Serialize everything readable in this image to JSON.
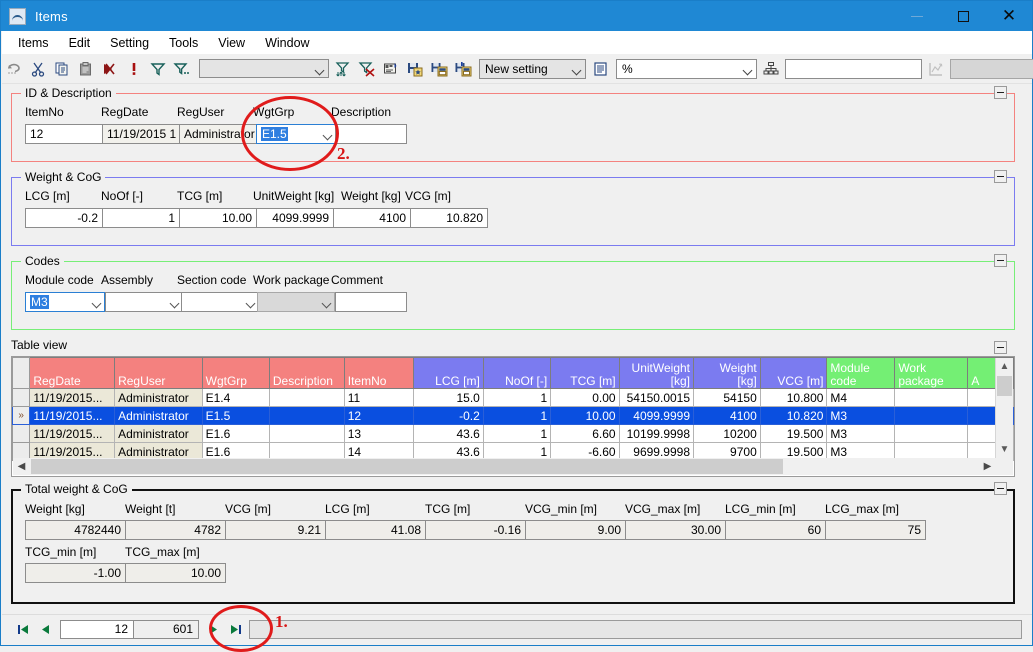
{
  "window": {
    "title": "Items",
    "icon": "app-icon",
    "buttons": {
      "minimize": "—",
      "maximize": "□",
      "close": "✕"
    }
  },
  "menu": {
    "items": [
      "Items",
      "Edit",
      "Setting",
      "Tools",
      "View",
      "Window"
    ]
  },
  "toolbar": {
    "icons": [
      "undo-icon",
      "cut-icon",
      "copy-icon",
      "paste-icon",
      "delete-record-icon",
      "exclamation-icon",
      "filter-icon",
      "filter-dots-icon",
      "sort-filter-icon",
      "clear-filter-icon",
      "properties-icon",
      "save-new-icon",
      "save-as-icon",
      "save-all-icon"
    ],
    "setting_combo": {
      "value": "New setting",
      "placeholder": ""
    },
    "filter_combo": {
      "value": "",
      "placeholder": ""
    },
    "unit_combo": {
      "value": "%",
      "placeholder": ""
    },
    "tree_text": {
      "value": "",
      "placeholder": ""
    },
    "chart_combo": {
      "value": "",
      "placeholder": ""
    },
    "report_icon": "report-icon",
    "tree_icon": "hierarchy-icon",
    "graph_icon": "graph-icon",
    "exit_icon": "exit-icon"
  },
  "id_description": {
    "legend": "ID & Description",
    "labels": {
      "itemno": "ItemNo",
      "regdate": "RegDate",
      "reguser": "RegUser",
      "wgtgrp": "WgtGrp",
      "description": "Description"
    },
    "values": {
      "itemno": "12",
      "regdate": "11/19/2015 1",
      "reguser": "Administrator",
      "wgtgrp": "E1.5",
      "description": ""
    }
  },
  "weight_cog": {
    "legend": "Weight & CoG",
    "labels": {
      "lcg": "LCG [m]",
      "noof": "NoOf [-]",
      "tcg": "TCG [m]",
      "unitweight": "UnitWeight [kg]",
      "weight": "Weight [kg]",
      "vcg": "VCG [m]"
    },
    "values": {
      "lcg": "-0.2",
      "noof": "1",
      "tcg": "10.00",
      "unitweight": "4099.9999",
      "weight": "4100",
      "vcg": "10.820"
    }
  },
  "codes": {
    "legend": "Codes",
    "labels": {
      "module": "Module code",
      "assembly": "Assembly",
      "section": "Section code",
      "workpackage": "Work package",
      "comment": "Comment"
    },
    "values": {
      "module": "M3",
      "assembly": "",
      "section": "",
      "workpackage": "",
      "comment": ""
    }
  },
  "table_view": {
    "legend": "Table view",
    "columns": [
      {
        "label": "RegDate",
        "color": "pink",
        "align": "left"
      },
      {
        "label": "RegUser",
        "color": "pink",
        "align": "left"
      },
      {
        "label": "WgtGrp",
        "color": "pink",
        "align": "left"
      },
      {
        "label": "Description",
        "color": "pink",
        "align": "left"
      },
      {
        "label": "ItemNo",
        "color": "pink",
        "align": "left"
      },
      {
        "label": "LCG [m]",
        "color": "blue",
        "align": "right"
      },
      {
        "label": "NoOf [-]",
        "color": "blue",
        "align": "right"
      },
      {
        "label": "TCG [m]",
        "color": "blue",
        "align": "right"
      },
      {
        "label": "UnitWeight [kg]",
        "color": "blue",
        "align": "right"
      },
      {
        "label": "Weight [kg]",
        "color": "blue",
        "align": "right"
      },
      {
        "label": "VCG [m]",
        "color": "blue",
        "align": "right"
      },
      {
        "label": "Module code",
        "color": "green",
        "align": "left"
      },
      {
        "label": "Work package",
        "color": "green",
        "align": "left"
      },
      {
        "label": "A",
        "color": "green",
        "align": "left"
      }
    ],
    "rows": [
      {
        "selected": false,
        "marker": "",
        "cells": [
          "11/19/2015...",
          "Administrator",
          "E1.4",
          "",
          "11",
          "15.0",
          "1",
          "0.00",
          "54150.0015",
          "54150",
          "10.800",
          "M4",
          "",
          ""
        ]
      },
      {
        "selected": true,
        "marker": "»",
        "cells": [
          "11/19/2015...",
          "Administrator",
          "E1.5",
          "",
          "12",
          "-0.2",
          "1",
          "10.00",
          "4099.9999",
          "4100",
          "10.820",
          "M3",
          "",
          ""
        ]
      },
      {
        "selected": false,
        "marker": "",
        "cells": [
          "11/19/2015...",
          "Administrator",
          "E1.6",
          "",
          "13",
          "43.6",
          "1",
          "6.60",
          "10199.9998",
          "10200",
          "19.500",
          "M3",
          "",
          ""
        ]
      },
      {
        "selected": false,
        "marker": "",
        "cells": [
          "11/19/2015...",
          "Administrator",
          "E1.6",
          "",
          "14",
          "43.6",
          "1",
          "-6.60",
          "9699.9998",
          "9700",
          "19.500",
          "M3",
          "",
          ""
        ]
      }
    ]
  },
  "total_weight": {
    "legend": "Total weight & CoG",
    "row1_labels": {
      "weight_kg": "Weight [kg]",
      "weight_t": "Weight [t]",
      "vcg": "VCG [m]",
      "lcg": "LCG [m]",
      "tcg": "TCG [m]",
      "vcg_min": "VCG_min [m]",
      "vcg_max": "VCG_max [m]",
      "lcg_min": "LCG_min [m]",
      "lcg_max": "LCG_max [m]"
    },
    "row1_values": {
      "weight_kg": "4782440",
      "weight_t": "4782",
      "vcg": "9.21",
      "lcg": "41.08",
      "tcg": "-0.16",
      "vcg_min": "9.00",
      "vcg_max": "30.00",
      "lcg_min": "60",
      "lcg_max": "75"
    },
    "row2_labels": {
      "tcg_min": "TCG_min [m]",
      "tcg_max": "TCG_max [m]"
    },
    "row2_values": {
      "tcg_min": "-1.00",
      "tcg_max": "10.00"
    }
  },
  "navbar": {
    "first_icon": "first-record-icon",
    "prev_icon": "prev-record-icon",
    "next_icon": "next-record-icon",
    "last_icon": "last-record-icon",
    "current": "12",
    "total": "601",
    "status": ""
  },
  "annotations": [
    {
      "id": "1",
      "label": "1."
    },
    {
      "id": "2",
      "label": "2."
    }
  ],
  "colors": {
    "titlebar": "#1f88d4",
    "header_pink": "#f4817f",
    "header_blue": "#7b7bf0",
    "header_green": "#74ef74",
    "row_selected": "#0a4fe0",
    "annotation_red": "#e01b1b"
  }
}
